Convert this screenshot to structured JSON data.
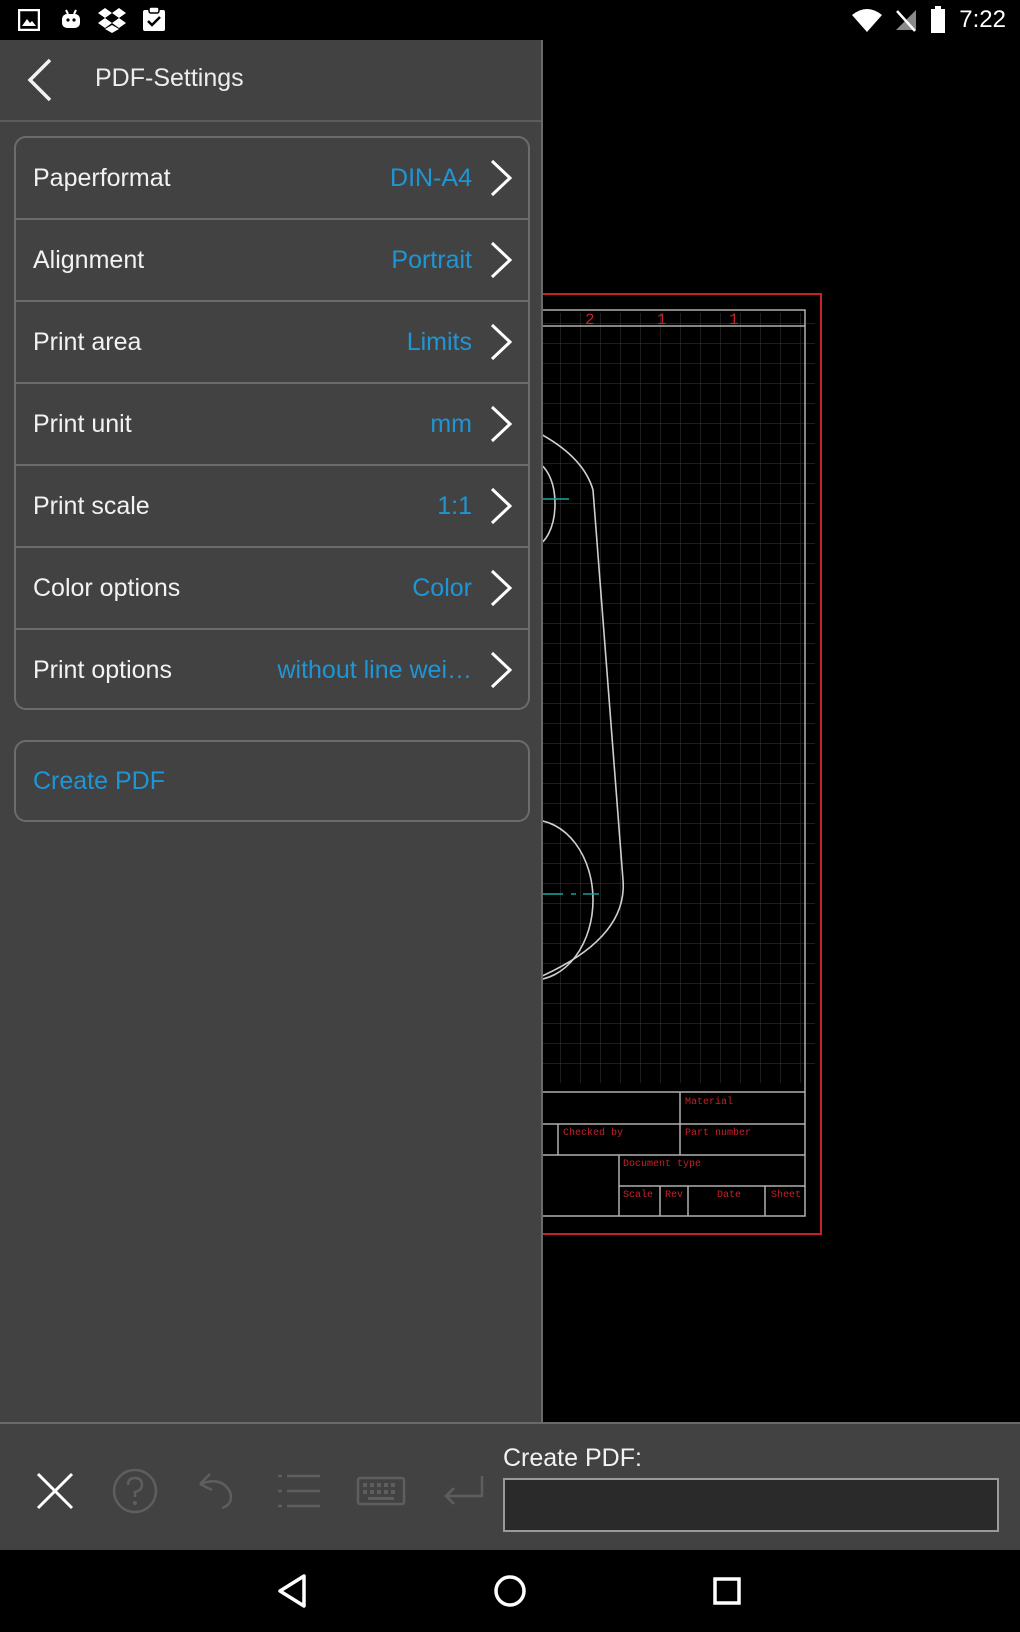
{
  "status_bar": {
    "time": "7:22",
    "left_icons": [
      "image-icon",
      "android-debug-icon",
      "dropbox-icon",
      "clipboard-check-icon"
    ],
    "right_icons": [
      "wifi-icon",
      "no-signal-icon",
      "battery-icon"
    ]
  },
  "panel": {
    "title": "PDF-Settings",
    "rows": [
      {
        "label": "Paperformat",
        "value": "DIN-A4"
      },
      {
        "label": "Alignment",
        "value": "Portrait"
      },
      {
        "label": "Print area",
        "value": "Limits"
      },
      {
        "label": "Print unit",
        "value": "mm"
      },
      {
        "label": "Print scale",
        "value": "1:1"
      },
      {
        "label": "Color options",
        "value": "Color"
      },
      {
        "label": "Print options",
        "value": "without line wei…"
      }
    ],
    "create_button": "Create PDF"
  },
  "drawing": {
    "header_numbers": [
      "2",
      "1",
      "1"
    ],
    "title_block": {
      "material": "Material",
      "checked_by": "Checked by",
      "part_number": "Part number",
      "document_type": "Document type",
      "scale": "Scale",
      "rev": "Rev",
      "date": "Date",
      "sheet": "Sheet"
    }
  },
  "toolbar": {
    "icons": [
      "close-icon",
      "help-icon",
      "undo-icon",
      "list-icon",
      "keyboard-icon",
      "enter-icon"
    ],
    "command_label": "Create PDF:",
    "command_value": ""
  },
  "nav_bar": {
    "icons": [
      "back-triangle-icon",
      "home-circle-icon",
      "recents-square-icon"
    ]
  },
  "colors": {
    "accent": "#1e96d6",
    "panel_bg": "#424242",
    "drawing_border": "#c8202a"
  }
}
